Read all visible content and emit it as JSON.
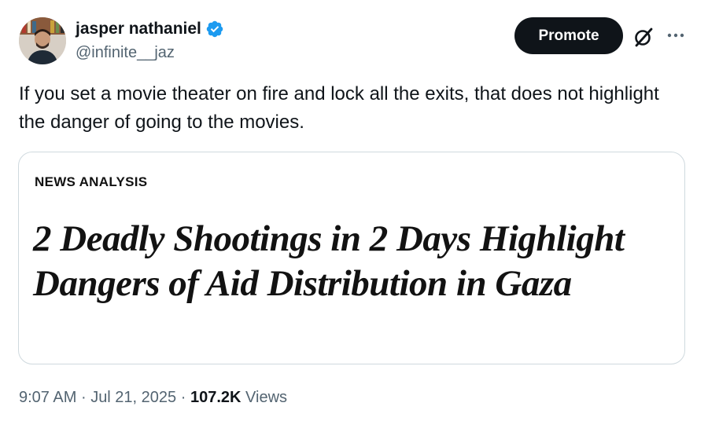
{
  "author": {
    "display_name": "jasper nathaniel",
    "handle": "@infinite__jaz",
    "verified": true
  },
  "actions": {
    "promote_label": "Promote"
  },
  "tweet": {
    "text": "If you set a movie theater on fire and lock all the exits, that does not highlight the danger of going to the movies."
  },
  "card": {
    "kicker": "NEWS ANALYSIS",
    "headline": "2 Deadly Shootings in 2 Days Highlight Dangers of Aid Distribution in Gaza"
  },
  "meta": {
    "time": "9:07 AM",
    "separator": "·",
    "date": "Jul 21, 2025",
    "views_count": "107.2K",
    "views_label": "Views"
  },
  "colors": {
    "verified_blue": "#1d9bf0",
    "text_primary": "#0f1419",
    "text_secondary": "#536471",
    "border": "#cfd9de"
  }
}
